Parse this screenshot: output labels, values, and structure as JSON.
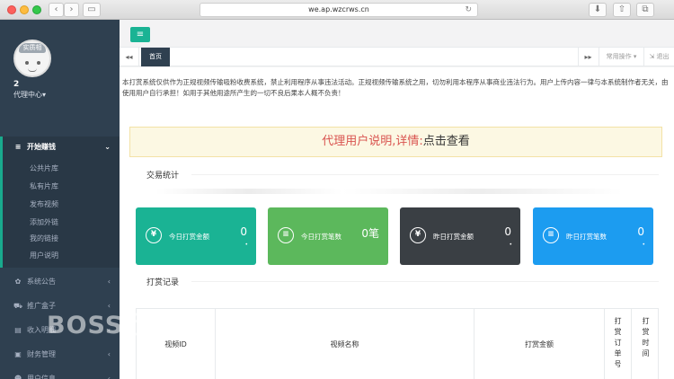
{
  "browser": {
    "url": "we.ap.wzcrws.cn",
    "back_glyph": "‹",
    "forward_glyph": "›",
    "reload_glyph": "↻"
  },
  "sidebar": {
    "avatar_cap": "实质相",
    "username": "2",
    "agent_center": "代理中心▾",
    "menu": [
      {
        "label": "开始赚钱",
        "icon": "layers-icon",
        "glyph": "≡",
        "arrow": "⌄"
      },
      {
        "label": "系统公告",
        "icon": "gear-icon",
        "glyph": "✿",
        "arrow": "‹"
      },
      {
        "label": "推广盒子",
        "icon": "car-icon",
        "glyph": "⛟",
        "arrow": "‹"
      },
      {
        "label": "收入明细",
        "icon": "list-icon",
        "glyph": "▤",
        "arrow": "‹"
      },
      {
        "label": "财务管理",
        "icon": "briefcase-icon",
        "glyph": "▣",
        "arrow": "‹"
      },
      {
        "label": "用户信息",
        "icon": "users-icon",
        "glyph": "☻",
        "arrow": "‹"
      }
    ],
    "submenu": [
      "公共片库",
      "私有片库",
      "发布视频",
      "添加外链",
      "我的链接",
      "用户说明"
    ]
  },
  "topbar": {
    "menu_glyph": "≡"
  },
  "tabs": {
    "prev_glyph": "◂◂",
    "next_glyph": "▸▸",
    "home": "首页",
    "common_ops": "常用操作 ▾",
    "logout": "⇲ 退出"
  },
  "content": {
    "notice": "本打赏系统仅供作为正规视频传输吸粉收费系统，禁止利用程序从事违法活动。正规视频传输系统之用，切勿利用本程序从事商业违法行为。用户上传内容一律与本系统制作者无关，由使用用户自行承担！如用于其他用途所产生的一切不良后果本人概不负责！",
    "banner_red": "代理用户说明,详情:",
    "banner_link": "点击查看",
    "stats_title": "交易统计",
    "records_title": "打赏记录",
    "cards": [
      {
        "label": "今日打赏金额",
        "value": "0",
        "dot": "•",
        "icon": "yen-icon",
        "glyph": "¥",
        "color": "#1ab394"
      },
      {
        "label": "今日打赏笔数",
        "value": "0笔",
        "dot": "",
        "icon": "list-circle-icon",
        "glyph": "≡",
        "color": "#5cb85c"
      },
      {
        "label": "昨日打赏金额",
        "value": "0",
        "dot": "•",
        "icon": "yen-icon",
        "glyph": "¥",
        "color": "#3a3f44"
      },
      {
        "label": "昨日打赏笔数",
        "value": "0",
        "dot": "•",
        "icon": "list-circle-icon",
        "glyph": "≡",
        "color": "#1c9cf0"
      }
    ],
    "table_headers": [
      "视频ID",
      "视频名称",
      "打赏金额",
      "打赏订单号",
      "打赏时间"
    ]
  },
  "watermark": "BOSS 资源"
}
